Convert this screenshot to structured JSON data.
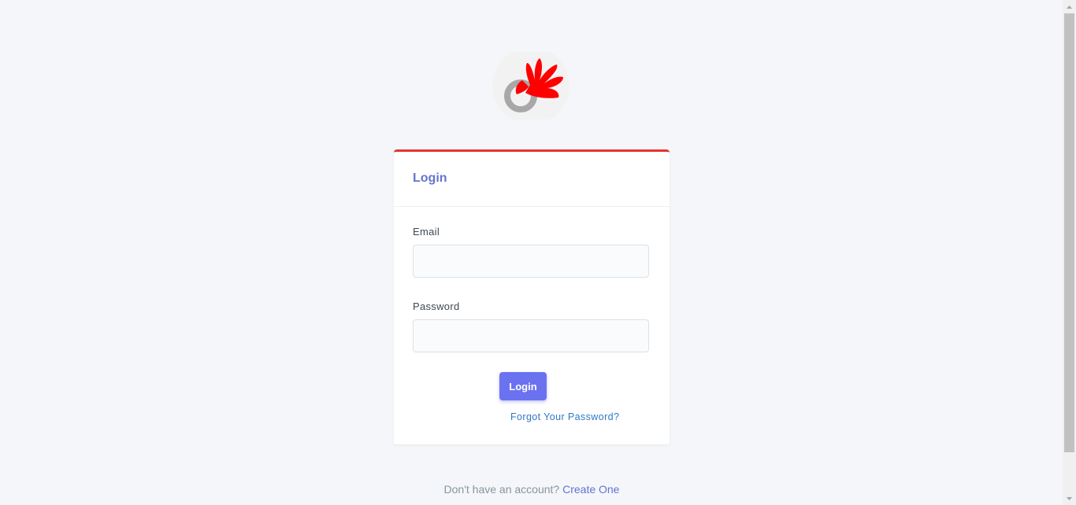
{
  "logo": {
    "icon": "hand-ring-logo",
    "colors": {
      "primary": "#ff0000",
      "secondary": "#a8a8a8"
    }
  },
  "card": {
    "title": "Login",
    "email_label": "Email",
    "email_value": "",
    "password_label": "Password",
    "password_value": "",
    "login_button": "Login",
    "forgot_link": "Forgot Your Password?"
  },
  "footer": {
    "prompt": "Don't have an account?",
    "create_link": "Create One"
  },
  "colors": {
    "accent": "#6574cd",
    "card_border_top": "#e3342f",
    "button": "#6b72f0",
    "link": "#2f79c4"
  }
}
